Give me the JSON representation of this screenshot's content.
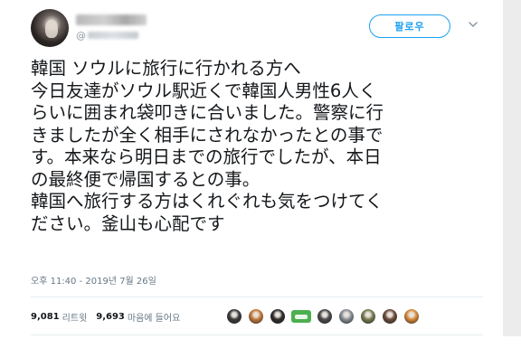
{
  "header": {
    "handle_at": "@",
    "follow_label": "팔로우"
  },
  "tweet": {
    "lines": [
      "韓国 ソウルに旅行に行かれる方へ",
      "今日友達がソウル駅近くで韓国人男性6人く",
      "らいに囲まれ袋叩きに合いました。警察に行",
      "きましたが全く相手にされなかったとの事で",
      "す。本来なら明日までの旅行でしたが、本日",
      "の最終便で帰国するとの事。",
      "韓国へ旅行する方はくれぐれも気をつけてく",
      "ださい。釜山も心配です"
    ],
    "timestamp": "오후 11:40 - 2019년 7월 26일"
  },
  "stats": {
    "retweets_count": "9,081",
    "retweets_label": "리트윗",
    "likes_count": "9,693",
    "likes_label": "마음에 들어요"
  },
  "likers": [
    {
      "icon": "avatar-dark-icon",
      "color": "#3a3a3a"
    },
    {
      "icon": "avatar-sunset-icon",
      "color": "#c47a3c"
    },
    {
      "icon": "avatar-figure-icon",
      "color": "#2e2b2a"
    },
    {
      "icon": "avatar-green-badge-icon",
      "color": "#4caf50"
    },
    {
      "icon": "avatar-dark-2-icon",
      "color": "#4a4a4a"
    },
    {
      "icon": "avatar-gray-icon",
      "color": "#8a8f96"
    },
    {
      "icon": "avatar-olive-icon",
      "color": "#7a7a52"
    },
    {
      "icon": "avatar-brown-icon",
      "color": "#6b4a3a"
    },
    {
      "icon": "avatar-colorful-icon",
      "color": "#d98a3a"
    }
  ],
  "colors": {
    "accent": "#1da1f2",
    "text": "#14171a",
    "muted": "#657786"
  }
}
